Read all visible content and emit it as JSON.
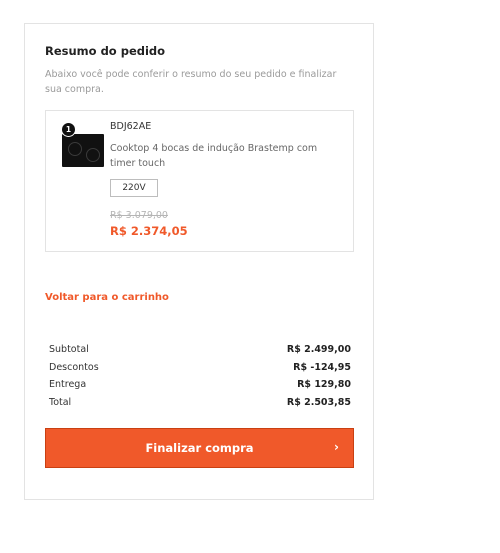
{
  "order_summary": {
    "title": "Resumo do pedido",
    "description": "Abaixo você pode conferir o resumo do seu pedido e finalizar sua compra."
  },
  "item": {
    "quantity": "1",
    "sku": "BDJ62AE",
    "name": "Cooktop 4 bocas de indução Brastemp com timer touch",
    "voltage": "220V",
    "old_price": "R$ 3.079,00",
    "price": "R$ 2.374,05"
  },
  "back_link": "Voltar para o carrinho",
  "totals": [
    {
      "label": "Subtotal",
      "value": "R$ 2.499,00"
    },
    {
      "label": "Descontos",
      "value": "R$ -124,95"
    },
    {
      "label": "Entrega",
      "value": "R$ 129,80"
    },
    {
      "label": "Total",
      "value": "R$ 2.503,85"
    }
  ],
  "checkout_button": {
    "label": "Finalizar compra",
    "icon": "chevron-right-icon"
  },
  "colors": {
    "accent": "#f0592a",
    "border": "#e3e3e3",
    "muted_text": "#9a9a9a"
  }
}
